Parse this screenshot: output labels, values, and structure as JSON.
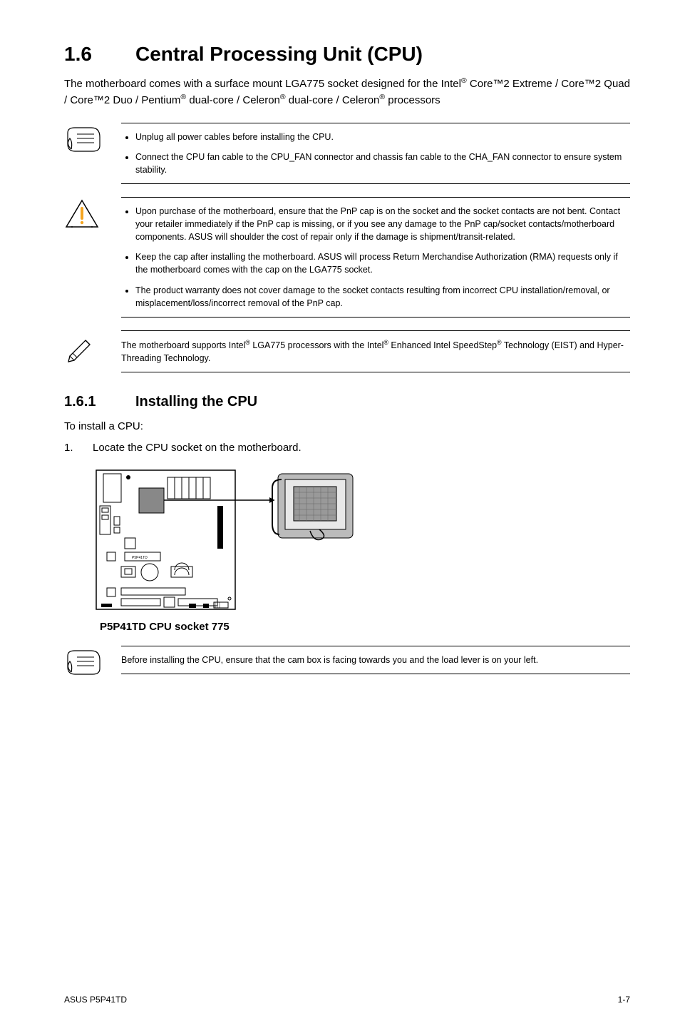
{
  "section": {
    "number": "1.6",
    "title": "Central Processing Unit (CPU)",
    "intro_html": "The motherboard comes with a surface mount LGA775 socket designed for the Intel<sup>®</sup> Core™2 Extreme / Core™2 Quad / Core™2 Duo / Pentium<sup>®</sup> dual-core / Celeron<sup>®</sup> dual-core / Celeron<sup>®</sup> processors"
  },
  "note1": {
    "items": [
      "Unplug all power cables before installing the CPU.",
      "Connect the CPU fan cable to the CPU_FAN connector and chassis fan cable to the CHA_FAN connector to ensure system stability."
    ]
  },
  "note2": {
    "items": [
      "Upon purchase of the motherboard, ensure that the PnP cap is on the socket and the socket contacts are not bent. Contact your retailer immediately if the PnP cap is missing, or if you see any damage to the PnP cap/socket contacts/motherboard components. ASUS will shoulder the cost of repair only if the damage is shipment/transit-related.",
      "Keep the cap after installing the motherboard. ASUS will process Return Merchandise Authorization (RMA) requests only if the motherboard comes with the cap on the LGA775 socket.",
      "The product warranty does not cover damage to the socket contacts resulting from incorrect CPU installation/removal, or misplacement/loss/incorrect removal of the PnP cap."
    ]
  },
  "note3": {
    "text_html": "The motherboard supports Intel<sup>®</sup> LGA775 processors with the Intel<sup>®</sup> Enhanced Intel SpeedStep<sup>®</sup> Technology (EIST) and Hyper-Threading Technology."
  },
  "subsection": {
    "number": "1.6.1",
    "title": "Installing the CPU",
    "lead": "To install a CPU:",
    "step1": "Locate the CPU socket on the motherboard."
  },
  "figure": {
    "caption": "P5P41TD CPU socket 775"
  },
  "note4": {
    "text": "Before installing the CPU, ensure that the cam box is facing towards you and the load lever is on your left."
  },
  "footer": {
    "left": "ASUS P5P41TD",
    "right": "1-7"
  }
}
